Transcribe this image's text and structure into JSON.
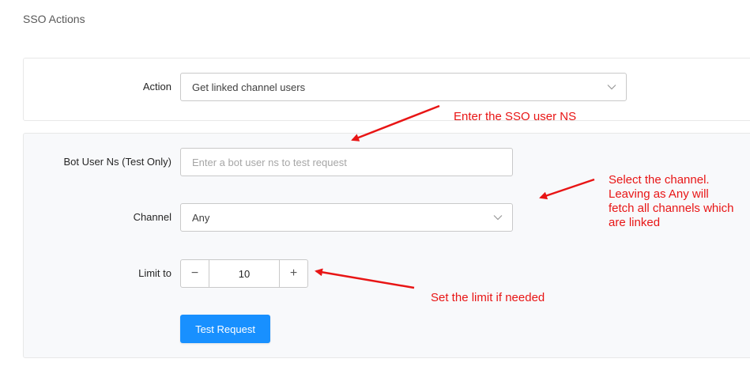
{
  "page": {
    "title": "SSO Actions"
  },
  "action": {
    "label": "Action",
    "selected": "Get linked channel users",
    "icon": "chevron-down-icon"
  },
  "bot_user_ns": {
    "label": "Bot User Ns (Test Only)",
    "value": "",
    "placeholder": "Enter a bot user ns to test request"
  },
  "channel": {
    "label": "Channel",
    "selected": "Any",
    "icon": "chevron-down-icon"
  },
  "limit": {
    "label": "Limit to",
    "value": "10",
    "minus_symbol": "−",
    "plus_symbol": "+"
  },
  "test_button": {
    "label": "Test Request"
  },
  "annotations": {
    "color": "#e81515",
    "sso_user_ns": "Enter the SSO user NS",
    "channel_lines": [
      "Select the channel.",
      "Leaving as Any will",
      "fetch all channels which",
      "are linked"
    ],
    "limit": "Set the limit if needed"
  },
  "colors": {
    "primary_button": "#1890ff",
    "annotation_red": "#e81515"
  }
}
